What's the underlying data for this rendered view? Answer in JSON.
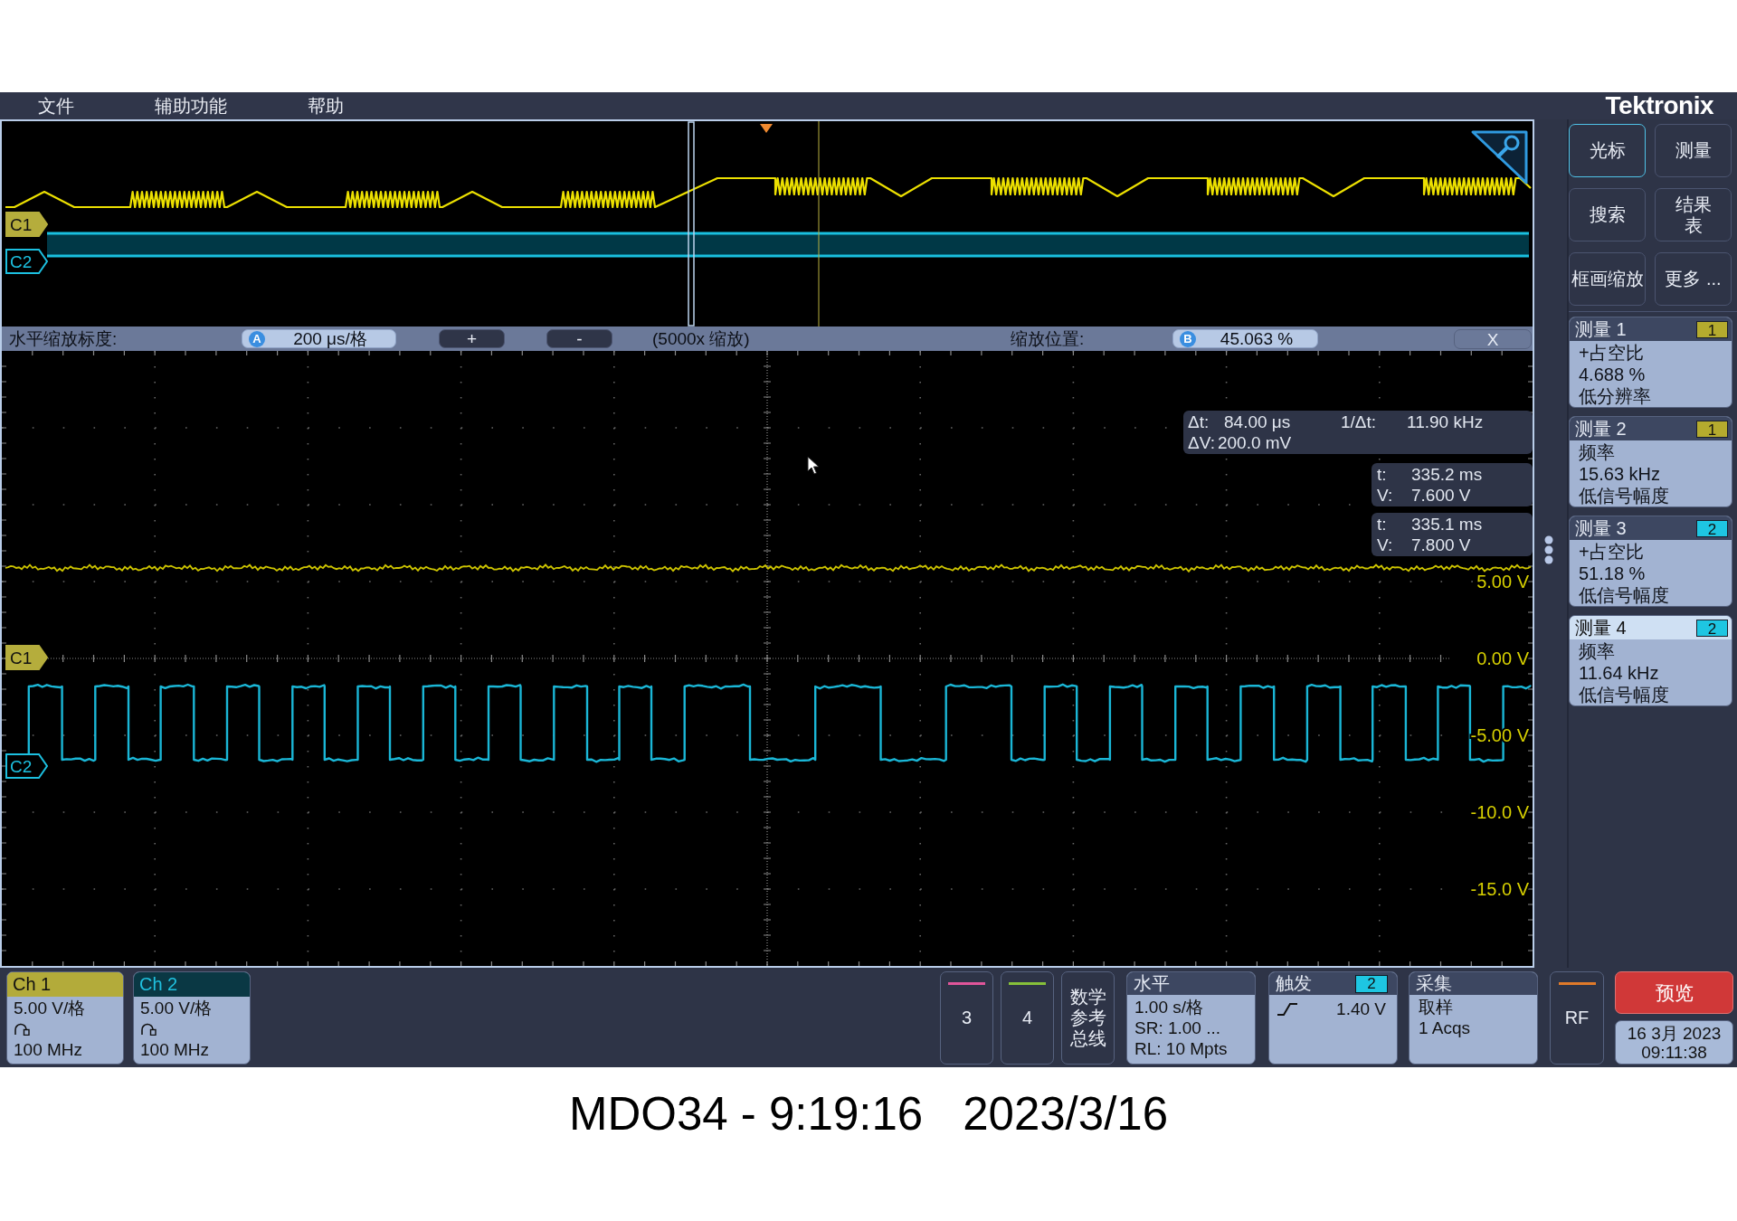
{
  "menu": [
    "文件",
    "辅助功能",
    "帮助"
  ],
  "brand": "Tektronix",
  "overview": {
    "markers": [
      {
        "label": "C1",
        "selected": true,
        "color": "#b5ad3c"
      },
      {
        "label": "C2",
        "selected": false,
        "color": "#1cc0e0"
      }
    ]
  },
  "zoom_bar": {
    "scale_label": "水平缩放标度:",
    "scale_badge": "A",
    "scale_value": "200 μs/格",
    "zoom_in": "+",
    "zoom_out": "-",
    "zoom_factor": "(5000x 缩放)",
    "position_label": "缩放位置:",
    "position_badge": "B",
    "position_value": "45.063 %",
    "close": "X"
  },
  "main": {
    "markers": [
      {
        "label": "C1",
        "selected": true,
        "color": "#b5ad3c"
      },
      {
        "label": "C2",
        "selected": false,
        "color": "#1cc0e0"
      }
    ],
    "scale_labels": [
      "5.00 V",
      "0.00 V",
      "-5.00 V",
      "-10.0 V",
      "-15.0 V"
    ],
    "readout": {
      "delta": [
        {
          "label": "Δt:",
          "value": "84.00 μs"
        },
        {
          "label": "ΔV:",
          "value": "200.0 mV"
        }
      ],
      "inverse": {
        "label": "1/Δt:",
        "value": "11.90 kHz"
      }
    },
    "cursors": [
      {
        "t_label": "t:",
        "t": "335.2 ms",
        "v_label": "V:",
        "v": "7.600 V"
      },
      {
        "t_label": "t:",
        "t": "335.1 ms",
        "v_label": "V:",
        "v": "7.800 V"
      }
    ]
  },
  "sidebar_buttons": [
    {
      "lines": [
        "光标"
      ],
      "selected": true
    },
    {
      "lines": [
        "测量"
      ],
      "selected": false
    },
    {
      "lines": [
        "搜索"
      ],
      "selected": false
    },
    {
      "lines": [
        "结果",
        "表"
      ],
      "selected": false
    },
    {
      "lines": [
        "框画缩放"
      ],
      "selected": false
    },
    {
      "lines": [
        "更多 ..."
      ],
      "selected": false
    }
  ],
  "measurements": [
    {
      "title": "测量 1",
      "badge": "1",
      "color": "#b5ab2e",
      "selected": false,
      "lines": [
        "+占空比",
        "4.688 %",
        "低分辨率"
      ]
    },
    {
      "title": "测量 2",
      "badge": "1",
      "color": "#b5ab2e",
      "selected": false,
      "lines": [
        "频率",
        "15.63 kHz",
        "低信号幅度"
      ]
    },
    {
      "title": "测量 3",
      "badge": "2",
      "color": "#1ec6e2",
      "selected": false,
      "lines": [
        "+占空比",
        "51.18 %",
        "低信号幅度"
      ]
    },
    {
      "title": "测量 4",
      "badge": "2",
      "color": "#1ec6e2",
      "selected": true,
      "lines": [
        "频率",
        "11.64 kHz",
        "低信号幅度"
      ]
    }
  ],
  "bottom": {
    "channels": [
      {
        "title": "Ch 1",
        "selected": true,
        "color": "#b3ab3a",
        "scale": "5.00 V/格",
        "bandwidth": "100 MHz"
      },
      {
        "title": "Ch 2",
        "selected": false,
        "color": "#20c0de",
        "scale": "5.00 V/格",
        "bandwidth": "100 MHz"
      }
    ],
    "channel_buttons": [
      {
        "label": "3",
        "color": "#e0559a"
      },
      {
        "label": "4",
        "color": "#86c03a"
      }
    ],
    "math_ref_bus": [
      "数学",
      "参考",
      "总线"
    ],
    "horizontal": {
      "title": "水平",
      "lines": [
        "1.00 s/格",
        "SR: 1.00 ...",
        "RL: 10 Mpts"
      ]
    },
    "trigger": {
      "title": "触发",
      "source": {
        "label": "2",
        "color": "#1ec6e2"
      },
      "level": "1.40 V"
    },
    "acquisition": {
      "title": "采集",
      "lines": [
        "取样",
        "1 Acqs"
      ]
    },
    "rf": {
      "label": "RF",
      "color": "#e07a2a"
    },
    "preview": "预览",
    "date": "16 3月 2023",
    "time": "09:11:38"
  },
  "caption": [
    "MDO34 - 9:19:16",
    "2023/3/16"
  ]
}
